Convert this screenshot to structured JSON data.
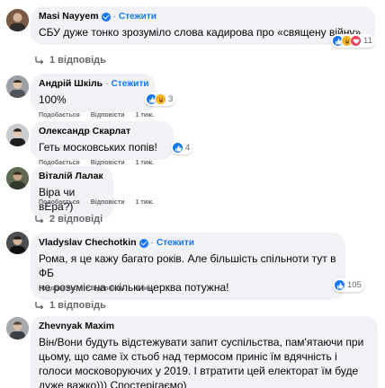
{
  "comments": [
    {
      "author": "Masi Nayyem",
      "verified": true,
      "follow": "Стежити",
      "text": "СБУ дуже тонко зрозуміло слова кадирова про «священу війну».",
      "reactions": {
        "icons": [
          "like",
          "haha",
          "love"
        ],
        "count": "11"
      },
      "actions": [],
      "replies": "1 відповідь"
    },
    {
      "author": "Андрій Шкіль",
      "verified": false,
      "follow": "Стежити",
      "text": "100%",
      "reactions": {
        "icons": [
          "like",
          "haha"
        ],
        "count": "3"
      },
      "actions": [
        "Подобається",
        "Відповісти",
        "1 тиж."
      ],
      "replies": ""
    },
    {
      "author": "Олександр Скарлат",
      "verified": false,
      "follow": "",
      "text": "Геть московських попів!",
      "reactions": {
        "icons": [
          "like"
        ],
        "count": "4"
      },
      "actions": [
        "Подобається",
        "Відповісти",
        "1 тиж."
      ],
      "replies": ""
    },
    {
      "author": "Віталій Лалак",
      "verified": false,
      "follow": "",
      "text": "Віра чи вЕра?)",
      "reactions": {
        "icons": [],
        "count": ""
      },
      "actions": [
        "Подобається",
        "Відповісти",
        "1 тиж."
      ],
      "replies": "2 відповіді"
    },
    {
      "author": "Vladyslav Chechotkin",
      "verified": true,
      "follow": "Стежити",
      "text_lines": [
        "Рома, я це кажу багато років. Але більшість спільноти тут в ФБ",
        "не розуміє на скільки церква потужна!"
      ],
      "reactions": {
        "icons": [
          "like"
        ],
        "count": "105"
      },
      "actions": [
        "Подобається",
        "Відповісти",
        "1 тиж."
      ],
      "replies": "1 відповідь"
    },
    {
      "author": "Zhevnyak Maxim",
      "verified": false,
      "follow": "",
      "text_lines": [
        "Він/Вони будуть відстежувати запит суспільства, пам'ятаючи при",
        "цьому, що саме їх стьоб над термосом приніс їм вдячність і",
        "голоси московоруючих у 2019. І втратити цей електорат їм буде",
        "дуже важко))) Спостерігаємо)"
      ],
      "reactions": {
        "icons": [],
        "count": ""
      },
      "actions": [],
      "replies": ""
    }
  ],
  "separator": "·"
}
